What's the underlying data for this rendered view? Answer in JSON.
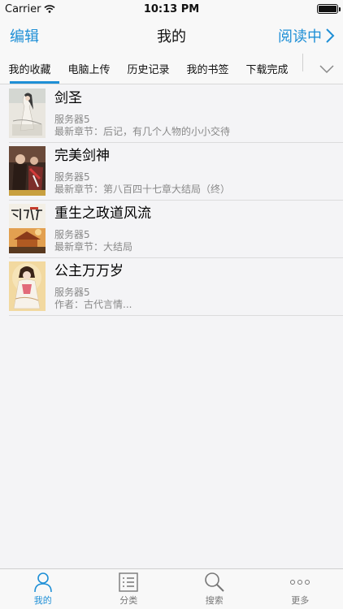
{
  "status_bar": {
    "carrier": "Carrier",
    "time": "10:13 PM"
  },
  "nav": {
    "edit_label": "编辑",
    "title": "我的",
    "reading_label": "阅读中"
  },
  "tabs": [
    {
      "label": "我的收藏",
      "active": true
    },
    {
      "label": "电脑上传",
      "active": false
    },
    {
      "label": "历史记录",
      "active": false
    },
    {
      "label": "我的书签",
      "active": false
    },
    {
      "label": "下载完成",
      "active": false
    }
  ],
  "books": [
    {
      "title": "剑圣",
      "server": "服务器5",
      "detail": "最新章节：后记，有几个人物的小小交待"
    },
    {
      "title": "完美剑神",
      "server": "服务器5",
      "detail": "最新章节：第八百四十七章大结局（终）"
    },
    {
      "title": "重生之政道风流",
      "server": "服务器5",
      "detail": "最新章节：大结局"
    },
    {
      "title": "公主万万岁",
      "server": "服务器5",
      "detail": "作者：古代言情..."
    }
  ],
  "tab_bar": [
    {
      "label": "我的",
      "icon": "person-icon",
      "active": true
    },
    {
      "label": "分类",
      "icon": "list-icon",
      "active": false
    },
    {
      "label": "搜索",
      "icon": "search-icon",
      "active": false
    },
    {
      "label": "更多",
      "icon": "more-icon",
      "active": false
    }
  ],
  "colors": {
    "accent": "#1e8fd6",
    "background": "#f4f4f6",
    "bar": "#f8f8f8"
  }
}
